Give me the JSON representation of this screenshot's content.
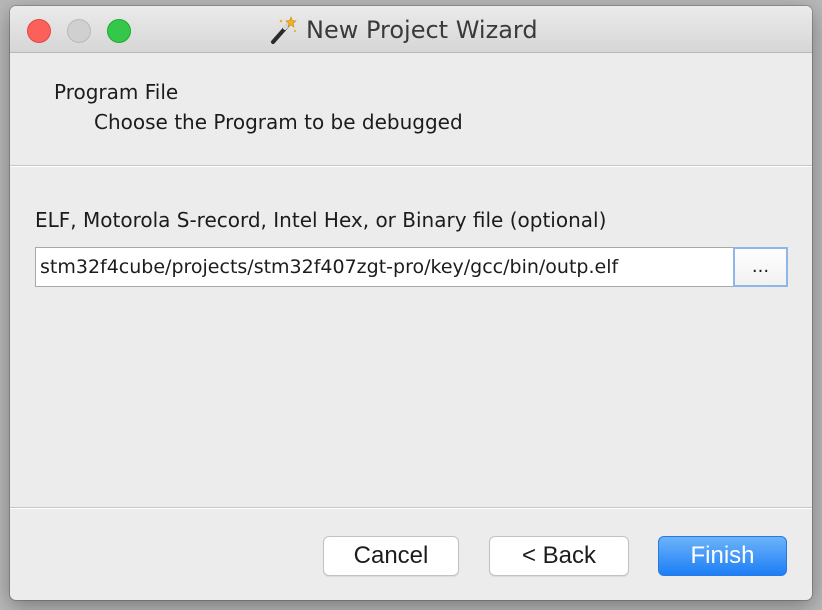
{
  "window": {
    "title": "New Project Wizard",
    "title_icon": "magic-wand-icon"
  },
  "header": {
    "title": "Program File",
    "subtitle": "Choose the Program to be debugged"
  },
  "program_file": {
    "label": "ELF, Motorola S-record, Intel Hex, or Binary file (optional)",
    "value": "stm32f4cube/projects/stm32f407zgt-pro/key/gcc/bin/outp.elf",
    "browse_label": "..."
  },
  "buttons": {
    "cancel": "Cancel",
    "back": "< Back",
    "finish": "Finish"
  },
  "colors": {
    "accent": "#1d7ef5",
    "close": "#fc605b",
    "zoom": "#34c84a"
  }
}
